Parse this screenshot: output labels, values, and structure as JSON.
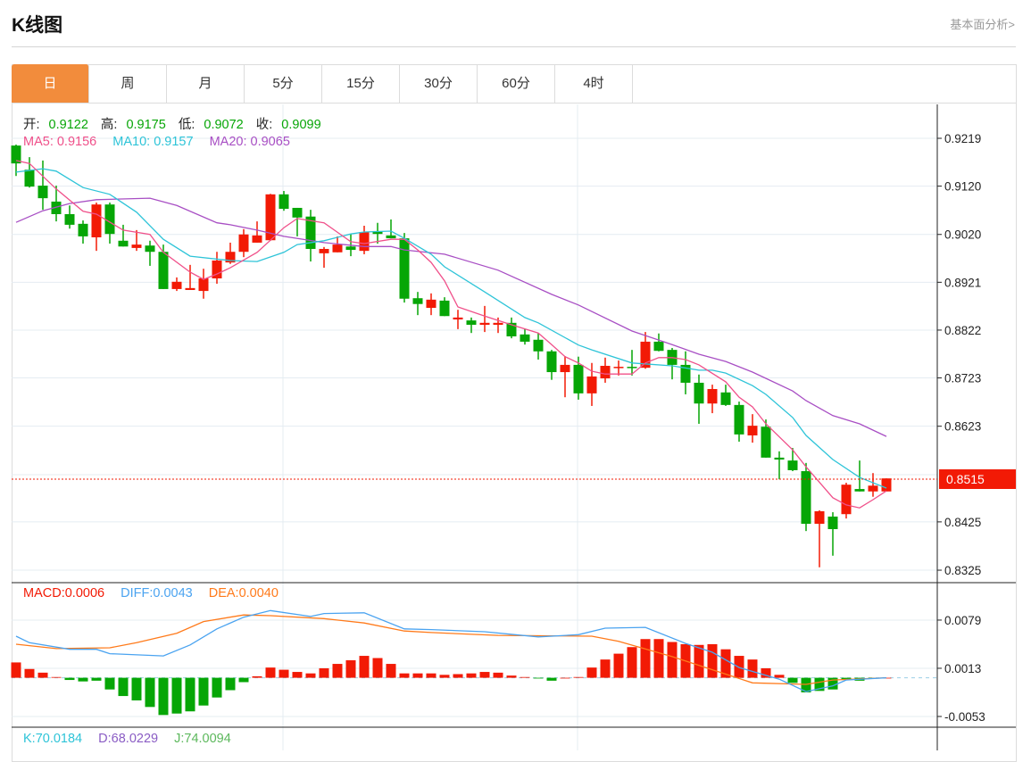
{
  "header": {
    "title": "K线图",
    "fundamental_link": "基本面分析>"
  },
  "tabs": [
    {
      "label": "日",
      "active": true
    },
    {
      "label": "周"
    },
    {
      "label": "月"
    },
    {
      "label": "5分"
    },
    {
      "label": "15分"
    },
    {
      "label": "30分"
    },
    {
      "label": "60分"
    },
    {
      "label": "4时"
    }
  ],
  "ohlc": {
    "open_label": "开:",
    "open": "0.9122",
    "high_label": "高:",
    "high": "0.9175",
    "low_label": "低:",
    "low": "0.9072",
    "close_label": "收:",
    "close": "0.9099"
  },
  "ma_legend": {
    "ma5": "MA5: 0.9156",
    "ma10": "MA10: 0.9157",
    "ma20": "MA20: 0.9065"
  },
  "macd_legend": {
    "macd": "MACD:0.0006",
    "diff": "DIFF:0.0043",
    "dea": "DEA:0.0040"
  },
  "kdj_legend": {
    "k": "K:70.0184",
    "d": "D:68.0229",
    "j": "J:74.0094"
  },
  "colors": {
    "up": "#f21a05",
    "down": "#06a606",
    "ma5": "#f0508a",
    "ma10": "#2ec4d8",
    "ma20": "#a84fc4",
    "diff": "#4aa3f0",
    "dea": "#ff7a1a",
    "accent": "#f28c3c"
  },
  "chart_data": [
    {
      "type": "candlestick",
      "title": "K线图",
      "y_ticks": [
        "0.9219",
        "0.9120",
        "0.9020",
        "0.8921",
        "0.8822",
        "0.8723",
        "0.8623",
        "0.8425",
        "0.8325"
      ],
      "ylim": [
        0.8325,
        0.9219
      ],
      "current_price": "0.8515",
      "candles_ohlc": [
        [
          0.9204,
          0.9206,
          0.9141,
          0.9167
        ],
        [
          0.9154,
          0.918,
          0.9117,
          0.9119
        ],
        [
          0.9121,
          0.9173,
          0.9071,
          0.9095
        ],
        [
          0.9088,
          0.9121,
          0.9047,
          0.9062
        ],
        [
          0.9062,
          0.908,
          0.9032,
          0.904
        ],
        [
          0.9042,
          0.9049,
          0.9001,
          0.9016
        ],
        [
          0.9014,
          0.9086,
          0.8986,
          0.9082
        ],
        [
          0.9082,
          0.9086,
          0.9001,
          0.9021
        ],
        [
          0.9007,
          0.904,
          0.8995,
          0.8995
        ],
        [
          0.8992,
          0.9029,
          0.8986,
          0.8999
        ],
        [
          0.8997,
          0.9007,
          0.8955,
          0.8984
        ],
        [
          0.8984,
          0.8999,
          0.8907,
          0.8907
        ],
        [
          0.8907,
          0.8931,
          0.8903,
          0.8922
        ],
        [
          0.8905,
          0.8957,
          0.8905,
          0.8909
        ],
        [
          0.8903,
          0.8949,
          0.8887,
          0.8929
        ],
        [
          0.8929,
          0.8984,
          0.8918,
          0.8966
        ],
        [
          0.8962,
          0.9003,
          0.8959,
          0.8984
        ],
        [
          0.8984,
          0.9031,
          0.8973,
          0.902
        ],
        [
          0.9003,
          0.9047,
          0.9003,
          0.9018
        ],
        [
          0.9008,
          0.9104,
          0.9007,
          0.9103
        ],
        [
          0.9103,
          0.911,
          0.9069,
          0.9073
        ],
        [
          0.9075,
          0.9075,
          0.9016,
          0.9055
        ],
        [
          0.9057,
          0.9071,
          0.8964,
          0.899
        ],
        [
          0.8981,
          0.8994,
          0.8951,
          0.899
        ],
        [
          0.8983,
          0.9016,
          0.8983,
          0.8999
        ],
        [
          0.8995,
          0.9021,
          0.8975,
          0.8988
        ],
        [
          0.8986,
          0.9038,
          0.8979,
          0.9025
        ],
        [
          0.9027,
          0.9044,
          0.9001,
          0.9021
        ],
        [
          0.9018,
          0.9051,
          0.9012,
          0.9012
        ],
        [
          0.9012,
          0.9023,
          0.8879,
          0.8887
        ],
        [
          0.8888,
          0.8901,
          0.8853,
          0.8876
        ],
        [
          0.8868,
          0.8898,
          0.8853,
          0.8885
        ],
        [
          0.8883,
          0.889,
          0.8851,
          0.8851
        ],
        [
          0.8844,
          0.8864,
          0.8824,
          0.8848
        ],
        [
          0.8842,
          0.8848,
          0.8816,
          0.8833
        ],
        [
          0.8833,
          0.8872,
          0.8818,
          0.8837
        ],
        [
          0.8833,
          0.8848,
          0.8816,
          0.8837
        ],
        [
          0.8837,
          0.8848,
          0.8805,
          0.8809
        ],
        [
          0.8813,
          0.8824,
          0.8792,
          0.8798
        ],
        [
          0.8802,
          0.8816,
          0.8761,
          0.8778
        ],
        [
          0.8778,
          0.8781,
          0.8719,
          0.8735
        ],
        [
          0.8735,
          0.8768,
          0.8683,
          0.875
        ],
        [
          0.875,
          0.8767,
          0.8678,
          0.8691
        ],
        [
          0.8691,
          0.8754,
          0.8665,
          0.8726
        ],
        [
          0.8722,
          0.8765,
          0.8713,
          0.8748
        ],
        [
          0.8744,
          0.8759,
          0.8728,
          0.8746
        ],
        [
          0.8746,
          0.8781,
          0.8728,
          0.8744
        ],
        [
          0.8744,
          0.8818,
          0.8742,
          0.8798
        ],
        [
          0.8798,
          0.8815,
          0.8778,
          0.8779
        ],
        [
          0.8781,
          0.8785,
          0.872,
          0.875
        ],
        [
          0.875,
          0.8778,
          0.8689,
          0.8713
        ],
        [
          0.8713,
          0.873,
          0.8628,
          0.867
        ],
        [
          0.867,
          0.8709,
          0.865,
          0.87
        ],
        [
          0.8693,
          0.8709,
          0.8665,
          0.8667
        ],
        [
          0.8667,
          0.8674,
          0.8591,
          0.8606
        ],
        [
          0.8604,
          0.8648,
          0.8589,
          0.8624
        ],
        [
          0.8622,
          0.8637,
          0.8558,
          0.8558
        ],
        [
          0.8558,
          0.8571,
          0.8513,
          0.8554
        ],
        [
          0.8552,
          0.8578,
          0.853,
          0.8532
        ],
        [
          0.853,
          0.8547,
          0.8406,
          0.8421
        ],
        [
          0.8421,
          0.8449,
          0.8331,
          0.8447
        ],
        [
          0.8436,
          0.8445,
          0.8355,
          0.841
        ],
        [
          0.8441,
          0.8506,
          0.8432,
          0.8502
        ],
        [
          0.8493,
          0.8552,
          0.8488,
          0.8488
        ],
        [
          0.8488,
          0.8526,
          0.8477,
          0.85
        ],
        [
          0.8488,
          0.8515,
          0.8488,
          0.8515
        ]
      ],
      "ma5": [
        [
          0,
          0.9173
        ],
        [
          1,
          0.9167
        ],
        [
          3,
          0.9114
        ],
        [
          5,
          0.9068
        ],
        [
          6,
          0.9062
        ],
        [
          8,
          0.9029
        ],
        [
          10,
          0.902
        ],
        [
          11,
          0.8983
        ],
        [
          13,
          0.8942
        ],
        [
          14,
          0.8927
        ],
        [
          15,
          0.8938
        ],
        [
          16,
          0.8951
        ],
        [
          18,
          0.8983
        ],
        [
          19,
          0.9008
        ],
        [
          20,
          0.9034
        ],
        [
          21,
          0.9053
        ],
        [
          23,
          0.9044
        ],
        [
          25,
          0.9005
        ],
        [
          26,
          0.9001
        ],
        [
          28,
          0.901
        ],
        [
          29,
          0.901
        ],
        [
          30,
          0.8988
        ],
        [
          31,
          0.8962
        ],
        [
          32,
          0.8924
        ],
        [
          33,
          0.887
        ],
        [
          35,
          0.8851
        ],
        [
          37,
          0.8833
        ],
        [
          39,
          0.8816
        ],
        [
          40,
          0.8792
        ],
        [
          41,
          0.8767
        ],
        [
          42,
          0.8754
        ],
        [
          43,
          0.8737
        ],
        [
          44,
          0.8731
        ],
        [
          46,
          0.8731
        ],
        [
          47,
          0.8754
        ],
        [
          48,
          0.8765
        ],
        [
          49,
          0.8765
        ],
        [
          50,
          0.8761
        ],
        [
          51,
          0.875
        ],
        [
          53,
          0.8715
        ],
        [
          54,
          0.8683
        ],
        [
          55,
          0.8663
        ],
        [
          56,
          0.8628
        ],
        [
          58,
          0.8574
        ],
        [
          59,
          0.8539
        ],
        [
          61,
          0.8475
        ],
        [
          62,
          0.846
        ],
        [
          63,
          0.8454
        ],
        [
          64,
          0.8471
        ],
        [
          65,
          0.8489
        ]
      ],
      "ma10": [
        [
          0,
          0.9149
        ],
        [
          2,
          0.9156
        ],
        [
          3,
          0.9151
        ],
        [
          5,
          0.9117
        ],
        [
          7,
          0.9103
        ],
        [
          9,
          0.9066
        ],
        [
          11,
          0.901
        ],
        [
          13,
          0.8975
        ],
        [
          16,
          0.8966
        ],
        [
          18,
          0.8964
        ],
        [
          20,
          0.8983
        ],
        [
          21,
          0.8999
        ],
        [
          23,
          0.9007
        ],
        [
          25,
          0.9021
        ],
        [
          26,
          0.9025
        ],
        [
          28,
          0.9027
        ],
        [
          29,
          0.9012
        ],
        [
          31,
          0.8979
        ],
        [
          32,
          0.8953
        ],
        [
          35,
          0.8901
        ],
        [
          38,
          0.8848
        ],
        [
          39,
          0.8837
        ],
        [
          42,
          0.8791
        ],
        [
          43,
          0.8781
        ],
        [
          46,
          0.8754
        ],
        [
          49,
          0.8748
        ],
        [
          51,
          0.8739
        ],
        [
          52,
          0.8739
        ],
        [
          53,
          0.8733
        ],
        [
          55,
          0.8707
        ],
        [
          56,
          0.8689
        ],
        [
          58,
          0.8641
        ],
        [
          59,
          0.8604
        ],
        [
          61,
          0.8554
        ],
        [
          63,
          0.8517
        ],
        [
          65,
          0.8495
        ]
      ],
      "ma20": [
        [
          0,
          0.9045
        ],
        [
          2,
          0.9069
        ],
        [
          4,
          0.9084
        ],
        [
          6,
          0.9092
        ],
        [
          10,
          0.9095
        ],
        [
          12,
          0.908
        ],
        [
          15,
          0.9044
        ],
        [
          16,
          0.904
        ],
        [
          18,
          0.9029
        ],
        [
          20,
          0.9016
        ],
        [
          23,
          0.9003
        ],
        [
          26,
          0.8995
        ],
        [
          28,
          0.8995
        ],
        [
          29,
          0.8988
        ],
        [
          32,
          0.8979
        ],
        [
          36,
          0.8946
        ],
        [
          40,
          0.8896
        ],
        [
          42,
          0.8874
        ],
        [
          46,
          0.882
        ],
        [
          49,
          0.8792
        ],
        [
          51,
          0.8772
        ],
        [
          53,
          0.8757
        ],
        [
          55,
          0.8735
        ],
        [
          58,
          0.8696
        ],
        [
          59,
          0.8676
        ],
        [
          61,
          0.8645
        ],
        [
          63,
          0.8628
        ],
        [
          65,
          0.8602
        ]
      ]
    },
    {
      "type": "bar+line",
      "title": "MACD",
      "y_ticks": [
        "0.0079",
        "0.0013",
        "-0.0053"
      ],
      "ylim": [
        -0.0065,
        0.0105
      ],
      "macd_hist": [
        0.0021,
        0.0012,
        0.0007,
        0.0001,
        -0.0003,
        -0.0005,
        -0.0004,
        -0.0016,
        -0.0025,
        -0.0031,
        -0.004,
        -0.0051,
        -0.0049,
        -0.0046,
        -0.0038,
        -0.0027,
        -0.0017,
        -0.0006,
        0.0002,
        0.0014,
        0.0011,
        0.0008,
        0.0006,
        0.0013,
        0.0019,
        0.0024,
        0.003,
        0.0027,
        0.0019,
        0.0006,
        0.0006,
        0.0006,
        0.0004,
        0.0005,
        0.0006,
        0.0008,
        0.0007,
        0.0003,
        0.0001,
        -0.0001,
        -0.0004,
        0.0,
        0.0001,
        0.0014,
        0.0025,
        0.0033,
        0.0042,
        0.0053,
        0.0053,
        0.0049,
        0.0046,
        0.0045,
        0.0046,
        0.0039,
        0.003,
        0.0025,
        0.0013,
        0.0004,
        -0.0007,
        -0.002,
        -0.0018,
        -0.0016,
        -0.0003,
        -0.0004,
        -0.0001,
        0.0
      ],
      "diff": [
        [
          0,
          0.0057
        ],
        [
          1,
          0.0048
        ],
        [
          4,
          0.0039
        ],
        [
          6,
          0.0039
        ],
        [
          7,
          0.0033
        ],
        [
          11,
          0.003
        ],
        [
          13,
          0.0045
        ],
        [
          15,
          0.0067
        ],
        [
          17,
          0.0083
        ],
        [
          19,
          0.0092
        ],
        [
          22,
          0.0084
        ],
        [
          23,
          0.0088
        ],
        [
          26,
          0.0089
        ],
        [
          29,
          0.0067
        ],
        [
          31,
          0.0066
        ],
        [
          35,
          0.0063
        ],
        [
          39,
          0.0056
        ],
        [
          42,
          0.0059
        ],
        [
          44,
          0.0068
        ],
        [
          47,
          0.0069
        ],
        [
          50,
          0.0047
        ],
        [
          52,
          0.0035
        ],
        [
          54,
          0.0014
        ],
        [
          57,
          -0.0002
        ],
        [
          59,
          -0.0019
        ],
        [
          61,
          -0.0011
        ],
        [
          62,
          -0.0003
        ],
        [
          65,
          0.0
        ]
      ],
      "dea": [
        [
          0,
          0.0046
        ],
        [
          3,
          0.004
        ],
        [
          7,
          0.0041
        ],
        [
          9,
          0.0048
        ],
        [
          12,
          0.0061
        ],
        [
          14,
          0.0077
        ],
        [
          17,
          0.0086
        ],
        [
          19,
          0.0085
        ],
        [
          23,
          0.0081
        ],
        [
          26,
          0.0075
        ],
        [
          29,
          0.0064
        ],
        [
          31,
          0.0062
        ],
        [
          36,
          0.0058
        ],
        [
          43,
          0.0057
        ],
        [
          45,
          0.005
        ],
        [
          49,
          0.0029
        ],
        [
          52,
          0.0011
        ],
        [
          55,
          -0.0007
        ],
        [
          59,
          -0.0009
        ],
        [
          61,
          -0.0003
        ],
        [
          65,
          0.0
        ]
      ]
    }
  ]
}
